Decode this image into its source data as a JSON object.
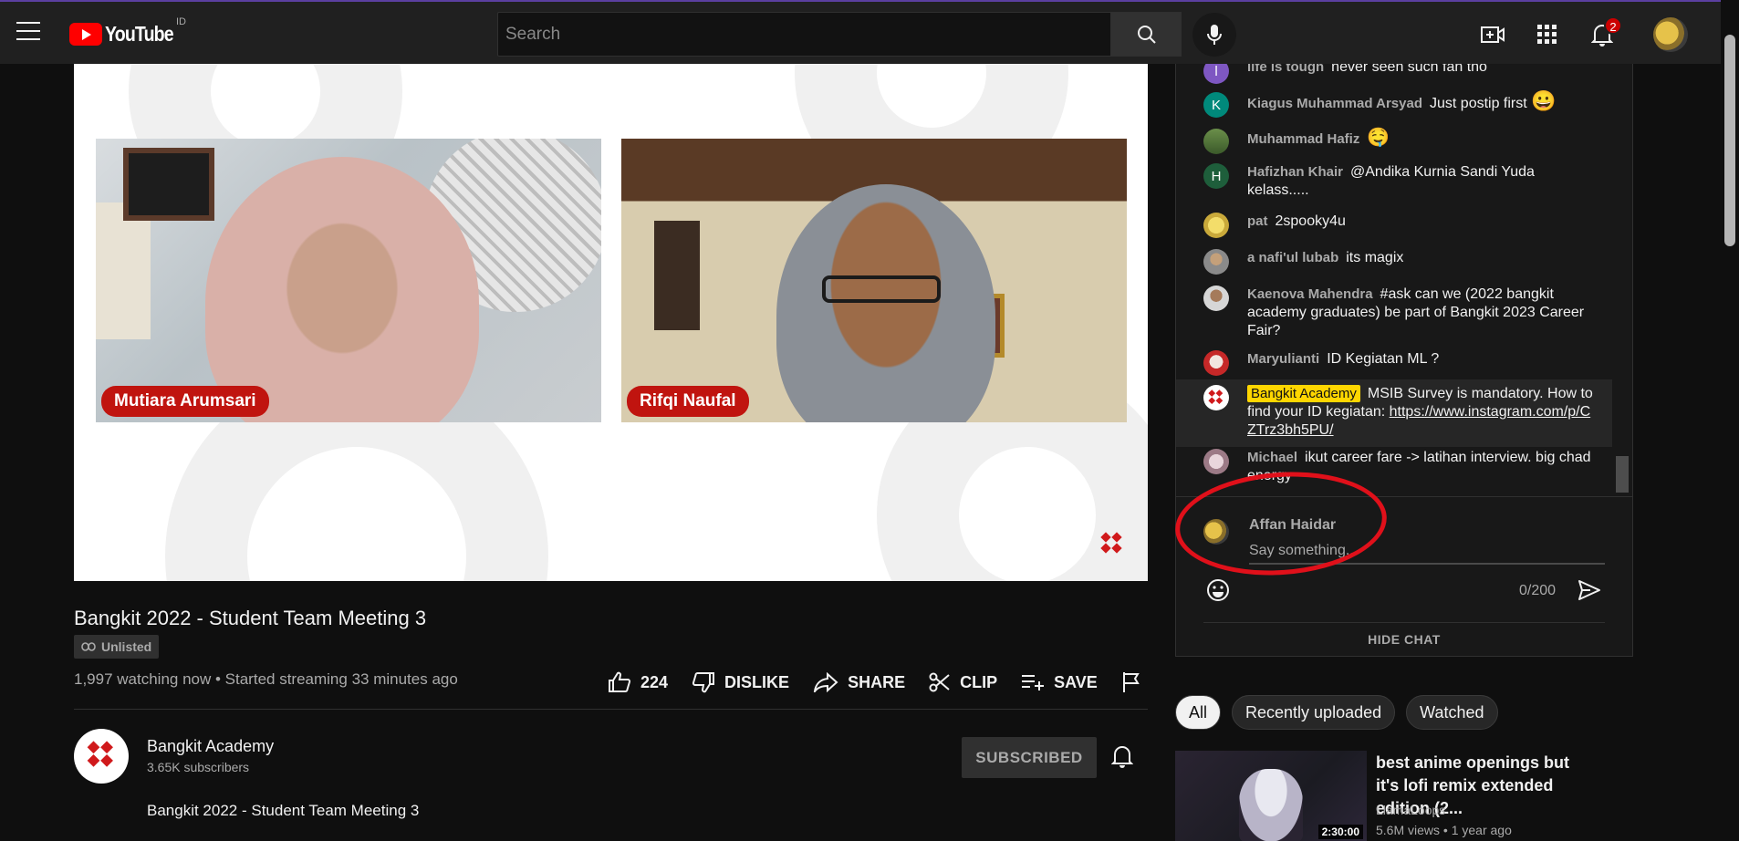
{
  "header": {
    "logo_text": "YouTube",
    "country_code": "ID",
    "search_placeholder": "Search",
    "notification_count": "2"
  },
  "video": {
    "participants": [
      "Mutiara Arumsari",
      "Rifqi Naufal"
    ],
    "title": "Bangkit 2022 - Student Team Meeting 3",
    "visibility": "Unlisted",
    "meta": "1,997 watching now • Started streaming 33 minutes ago",
    "actions": {
      "like_count": "224",
      "dislike": "DISLIKE",
      "share": "SHARE",
      "clip": "CLIP",
      "save": "SAVE"
    }
  },
  "channel": {
    "name": "Bangkit Academy",
    "subscribers": "3.65K subscribers",
    "subscribe_label": "SUBSCRIBED",
    "description": "Bangkit 2022 - Student Team Meeting 3"
  },
  "chat": {
    "messages": [
      {
        "author": "life is tough",
        "text": "never seen such fan tho",
        "avatar_letter": "l",
        "avatar_color": "#7e57c2"
      },
      {
        "author": "Kiagus Muhammad Arsyad",
        "text": "Just postip first",
        "emoji": "😀",
        "avatar_letter": "K",
        "avatar_color": "#00897b"
      },
      {
        "author": "Muhammad Hafiz",
        "text": "",
        "emoji": "🤤",
        "avatar_letter": "",
        "avatar_color": "#4e6a3a"
      },
      {
        "author": "Hafizhan Khair",
        "text": "@Andika Kurnia Sandi Yuda kelass.....",
        "avatar_letter": "H",
        "avatar_color": "#1e5e3b"
      },
      {
        "author": "pat",
        "text": "2spooky4u",
        "avatar_letter": "",
        "avatar_color": "#e0c24d"
      },
      {
        "author": "a nafi'ul lubab",
        "text": "its magix",
        "avatar_letter": "",
        "avatar_color": "#8a8a8a"
      },
      {
        "author": "Kaenova Mahendra",
        "text": "#ask can we (2022 bangkit academy graduates) be part of Bangkit 2023 Career Fair?",
        "avatar_letter": "",
        "avatar_color": "#6d6d6d"
      },
      {
        "author": "Maryulianti",
        "text": "ID Kegiatan ML ?",
        "avatar_letter": "",
        "avatar_color": "#c62828"
      },
      {
        "author": "Bangkit Academy",
        "text": "MSIB Survey is mandatory. How to find your ID kegiatan: ",
        "link": "https://www.instagram.com/p/CZTrz3bh5PU/",
        "owner": true,
        "avatar_letter": "",
        "avatar_color": "#ffffff"
      },
      {
        "author": "Michael",
        "text": "ikut career fare -> latihan interview. big chad energy",
        "avatar_letter": "",
        "avatar_color": "#b08a9a"
      }
    ],
    "input": {
      "user_name": "Affan Haidar",
      "placeholder": "Say something...",
      "char_count": "0/200"
    },
    "hide_chat": "HIDE CHAT"
  },
  "filter_chips": [
    "All",
    "Recently uploaded",
    "Watched"
  ],
  "recommendation": {
    "title": "best anime openings but it's lofi remix extended edition (2...",
    "channel": "LlamaLoops",
    "meta": "5.6M views • 1 year ago",
    "duration": "2:30:00"
  }
}
